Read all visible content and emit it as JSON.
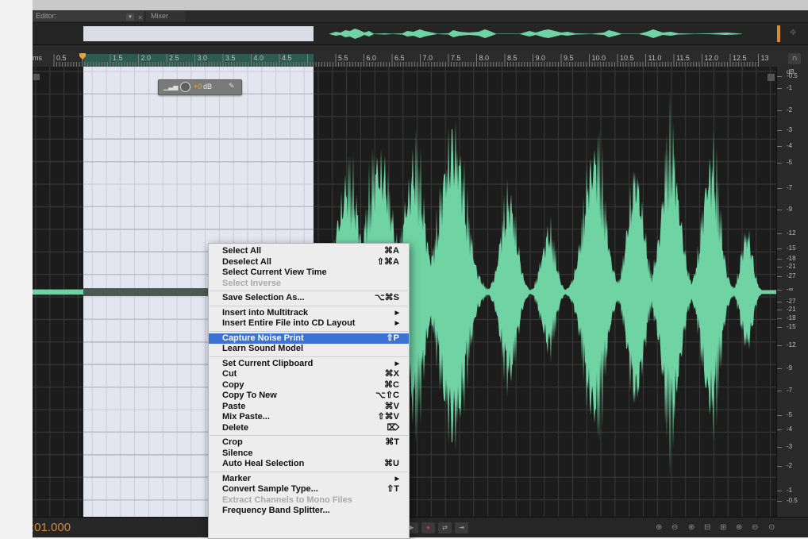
{
  "tabs": {
    "editor": "Editor:",
    "mixer": "Mixer"
  },
  "ruler": {
    "unit": "ms",
    "ticks": [
      "0.5",
      "1.5",
      "2.0",
      "2.5",
      "3.0",
      "3.5",
      "4.0",
      "4.5",
      "5.5",
      "6.0",
      "6.5",
      "7.0",
      "7.5",
      "8.0",
      "8.5",
      "9.0",
      "9.5",
      "10.0",
      "10.5",
      "11.0",
      "11.5",
      "12.0",
      "12.5",
      "13"
    ]
  },
  "hud": {
    "value": "+0",
    "unit": "dB"
  },
  "db_scale": {
    "unit": "dB",
    "labels": [
      "-0.5",
      "-1",
      "-2",
      "-3",
      "-4",
      "-5",
      "-7",
      "-9",
      "-12",
      "-15",
      "-18",
      "-21",
      "-27",
      "-∞",
      "-27",
      "-21",
      "-18",
      "-15",
      "-12",
      "-9",
      "-7",
      "-5",
      "-4",
      "-3",
      "-2",
      "-1",
      "-0.5"
    ]
  },
  "time_display": ":01.000",
  "context_menu": [
    {
      "label": "Select All",
      "shortcut": "⌘A"
    },
    {
      "label": "Deselect All",
      "shortcut": "⇧⌘A"
    },
    {
      "label": "Select Current View Time",
      "shortcut": ""
    },
    {
      "label": "Select Inverse",
      "shortcut": "",
      "disabled": true
    },
    {
      "sep": true
    },
    {
      "label": "Save Selection As...",
      "shortcut": "⌥⌘S"
    },
    {
      "sep": true
    },
    {
      "label": "Insert into Multitrack",
      "shortcut": "▶"
    },
    {
      "label": "Insert Entire File into CD Layout",
      "shortcut": "▶"
    },
    {
      "sep": true
    },
    {
      "label": "Capture Noise Print",
      "shortcut": "⇧P",
      "highlighted": true
    },
    {
      "label": "Learn Sound Model",
      "shortcut": ""
    },
    {
      "sep": true
    },
    {
      "label": "Set Current Clipboard",
      "shortcut": "▶"
    },
    {
      "label": "Cut",
      "shortcut": "⌘X"
    },
    {
      "label": "Copy",
      "shortcut": "⌘C"
    },
    {
      "label": "Copy To New",
      "shortcut": "⌥⇧C"
    },
    {
      "label": "Paste",
      "shortcut": "⌘V"
    },
    {
      "label": "Mix Paste...",
      "shortcut": "⇧⌘V"
    },
    {
      "label": "Delete",
      "shortcut": "⌦"
    },
    {
      "sep": true
    },
    {
      "label": "Crop",
      "shortcut": "⌘T"
    },
    {
      "label": "Silence",
      "shortcut": ""
    },
    {
      "label": "Auto Heal Selection",
      "shortcut": "⌘U"
    },
    {
      "sep": true
    },
    {
      "label": "Marker",
      "shortcut": "▶"
    },
    {
      "label": "Convert Sample Type...",
      "shortcut": "⇧T"
    },
    {
      "label": "Extract Channels to Mono Files",
      "shortcut": "",
      "disabled": true
    },
    {
      "label": "Frequency Band Splitter...",
      "shortcut": ""
    }
  ],
  "colors": {
    "waveform": "#6fd3a3",
    "selection": "#e3e6f0",
    "accent": "#e9a23b",
    "highlight": "#3c72d3"
  }
}
